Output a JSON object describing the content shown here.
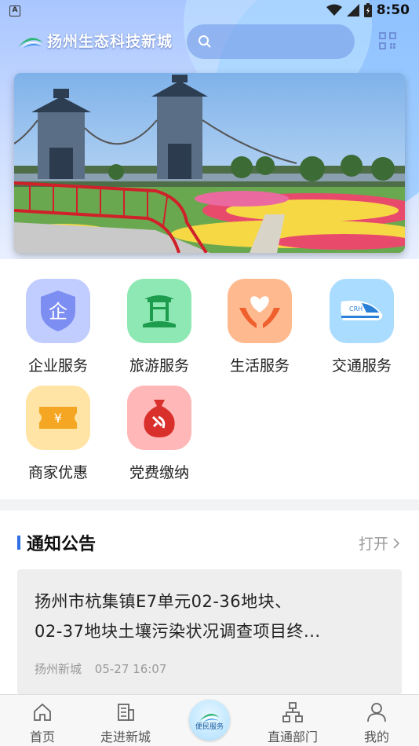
{
  "status_bar": {
    "time": "8:50",
    "left_icon_letter": "A"
  },
  "header": {
    "app_name": "扬州生态科技新城",
    "search": {
      "placeholder": ""
    }
  },
  "services": [
    {
      "label": "企业服务",
      "icon": "enterprise-shield-icon",
      "color": "#b9c8ff",
      "glyph": "企"
    },
    {
      "label": "旅游服务",
      "icon": "pavilion-icon",
      "color": "#8ae6b0"
    },
    {
      "label": "生活服务",
      "icon": "heart-hands-icon",
      "color": "#ffb48a"
    },
    {
      "label": "交通服务",
      "icon": "high-speed-train-icon",
      "color": "#a8dcff",
      "glyph": "CRH"
    },
    {
      "label": "商家优惠",
      "icon": "coupon-icon",
      "color": "#ffe2a0",
      "glyph": "¥"
    },
    {
      "label": "党费缴纳",
      "icon": "party-fee-bag-icon",
      "color": "#ffb3b3"
    }
  ],
  "notice": {
    "title": "通知公告",
    "more_label": "打开",
    "items": [
      {
        "headline_line1": "扬州市杭集镇E7单元02-36地块、",
        "headline_line2": "02-37地块土壤污染状况调查项目终...",
        "source": "扬州新城",
        "time": "05-27 16:07"
      }
    ]
  },
  "tabbar": {
    "home": "首页",
    "about": "走进新城",
    "center": "便民服务",
    "departments": "直通部门",
    "mine": "我的"
  },
  "colors": {
    "accent": "#2f6fe4",
    "muted": "#999999"
  }
}
